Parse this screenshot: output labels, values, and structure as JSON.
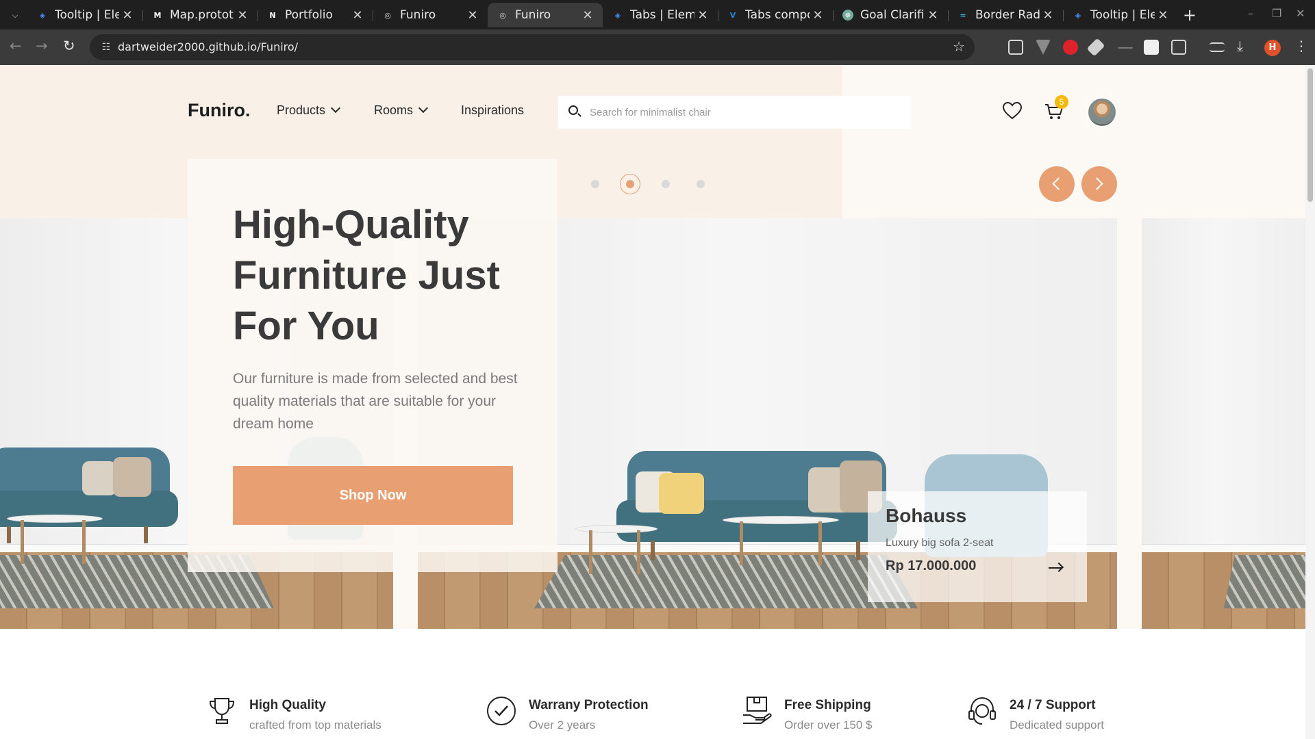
{
  "browser": {
    "tabs": [
      {
        "title": "Tooltip | Ele",
        "favicon": "element-icon"
      },
      {
        "title": "Map.protot",
        "favicon": "m-icon"
      },
      {
        "title": "Portfolio",
        "favicon": "n-icon"
      },
      {
        "title": "Funiro",
        "favicon": "globe-icon"
      },
      {
        "title": "Funiro",
        "favicon": "globe-icon",
        "active": true
      },
      {
        "title": "Tabs | Eleme",
        "favicon": "element-icon"
      },
      {
        "title": "Tabs compo",
        "favicon": "vuetify-icon"
      },
      {
        "title": "Goal Clarific",
        "favicon": "chatgpt-icon"
      },
      {
        "title": "Border Radi",
        "favicon": "tailwind-icon"
      },
      {
        "title": "Tooltip | Ele",
        "favicon": "element-icon"
      }
    ],
    "new_tab": "+",
    "url": "dartweider2000.github.io/Funiro/",
    "profile_initial": "H"
  },
  "header": {
    "logo": "Funiro.",
    "nav": [
      {
        "label": "Products",
        "has_dropdown": true
      },
      {
        "label": "Rooms",
        "has_dropdown": true
      },
      {
        "label": "Inspirations",
        "has_dropdown": false
      }
    ],
    "search_placeholder": "Search for minimalist chair",
    "cart_count": "5"
  },
  "hero": {
    "title": "High-Quality Furniture Just For You",
    "description": "Our furniture is made from selected and best quality materials that are suitable for your dream home",
    "cta": "Shop Now",
    "slider": {
      "dot_count": 4,
      "active_index": 1
    }
  },
  "product": {
    "name": "Bohauss",
    "description": "Luxury big sofa 2-seat",
    "price": "Rp 17.000.000"
  },
  "features": [
    {
      "icon": "trophy-icon",
      "title": "High Quality",
      "subtitle": "crafted from top materials"
    },
    {
      "icon": "check-badge-icon",
      "title": "Warrany Protection",
      "subtitle": "Over 2 years"
    },
    {
      "icon": "shipping-box-icon",
      "title": "Free Shipping",
      "subtitle": "Order over 150 $"
    },
    {
      "icon": "support-headset-icon",
      "title": "24 / 7 Support",
      "subtitle": "Dedicated support"
    }
  ],
  "colors": {
    "accent": "#e89f71",
    "beige": "#f9f1e7",
    "cream": "#fcf8f3",
    "badge": "#f5b80c",
    "chrome_dark": "#1f1f1f",
    "chrome_toolbar": "#3b3b3b"
  }
}
